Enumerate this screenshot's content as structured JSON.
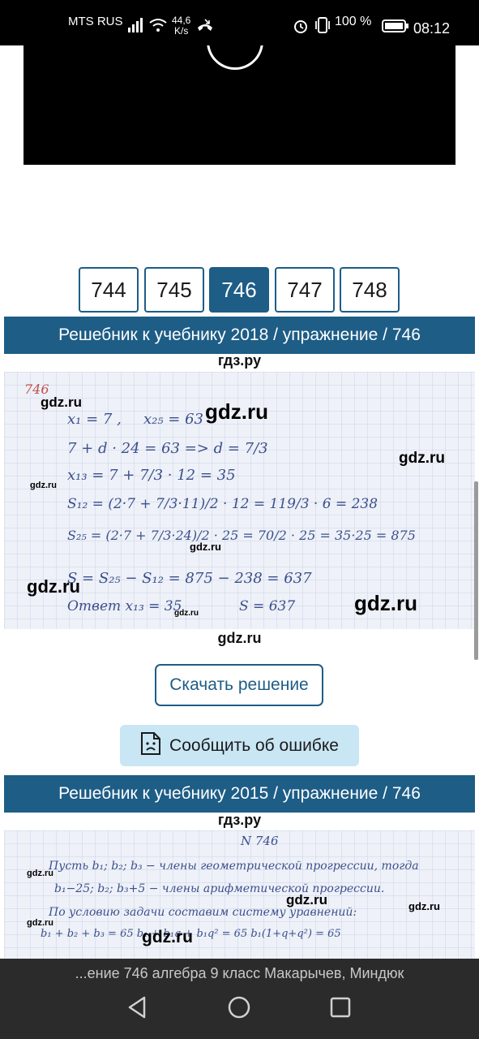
{
  "status": {
    "carrier": "MTS RUS",
    "speed_value": "44,6",
    "speed_unit": "K/s",
    "battery": "100 %",
    "time": "08:12"
  },
  "pager": {
    "items": [
      "744",
      "745",
      "746",
      "747",
      "748"
    ],
    "active_index": 2
  },
  "section1": {
    "header": "Решебник к учебнику 2018 / упражнение / 746",
    "caption_top": "гдз.ру",
    "caption_bottom": "gdz.ru",
    "watermark": "gdz.ru",
    "hw": {
      "num": "746",
      "l1a": "x₁ = 7 ,",
      "l1b": "x₂₅ = 63",
      "l2": "7 + d · 24 = 63   =>   d = 7/3",
      "l3": "x₁₃ = 7 + 7/3 · 12 = 35",
      "l4": "S₁₂ = (2·7 + 7/3·11)/2 · 12 = 119/3 · 6 = 238",
      "l5": "S₂₅ = (2·7 + 7/3·24)/2 · 25 = 70/2 · 25 = 35·25 = 875",
      "l6": "S = S₂₅ − S₁₂ = 875 − 238 = 637",
      "l7a": "Ответ  x₁₃ = 35",
      "l7b": "S = 637"
    }
  },
  "download_label": "Скачать решение",
  "report_label": "Сообщить об ошибке",
  "section2": {
    "header": "Решебник к учебнику 2015 / упражнение / 746",
    "caption_top": "гдз.ру",
    "watermark": "gdz.ru",
    "hw": {
      "num": "N 746",
      "l1": "Пусть b₁; b₂; b₃ − члены геометрической прогрессии, тогда",
      "l2": "b₁−25; b₂; b₃+5 − члены арифметической прогрессии.",
      "l3": "По условию задачи составим систему уравнений:",
      "l4": "b₁ + b₂ + b₃ = 65   b₁ + b₁q + b₁q² = 65   b₁(1+q+q²) = 65"
    }
  },
  "url_text": "...ение 746 алгебра 9 класс Макарычев, Миндюк"
}
